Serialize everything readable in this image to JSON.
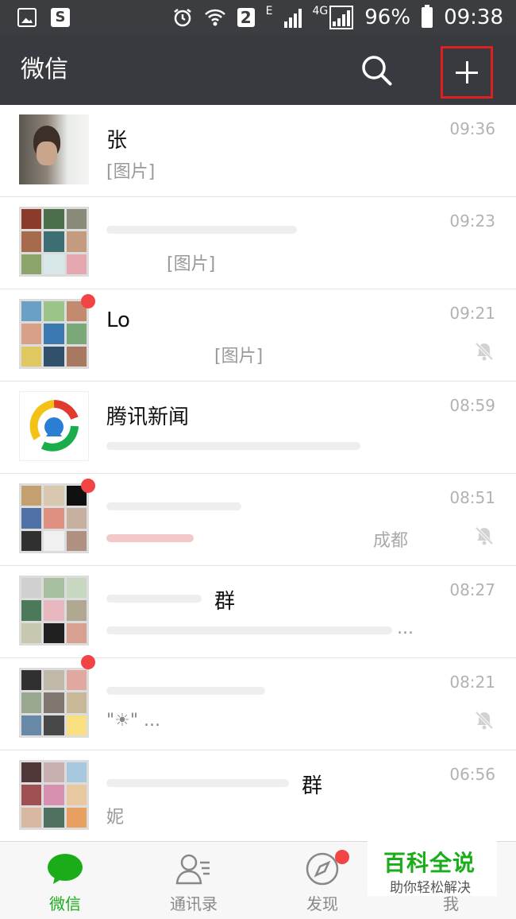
{
  "status_bar": {
    "battery": "96%",
    "time": "09:38",
    "network_badge": "2",
    "net_type": "4G",
    "edge": "E"
  },
  "header": {
    "title": "微信"
  },
  "chats": [
    {
      "name": "张",
      "preview": "[图片]",
      "time": "09:36",
      "muted": false,
      "unread": false
    },
    {
      "name": "",
      "preview": "[图片]",
      "time": "09:23",
      "muted": false,
      "unread": false
    },
    {
      "name": "Lo",
      "preview": "[图片]",
      "time": "09:21",
      "muted": true,
      "unread": true
    },
    {
      "name": "腾讯新闻",
      "preview": "",
      "time": "08:59",
      "muted": false,
      "unread": false
    },
    {
      "name": "",
      "preview": "成都",
      "time": "08:51",
      "muted": true,
      "unread": true
    },
    {
      "name": "群",
      "preview": "...",
      "time": "08:27",
      "muted": false,
      "unread": false
    },
    {
      "name": "",
      "preview": "\"☀\" ...",
      "time": "08:21",
      "muted": true,
      "unread": true
    },
    {
      "name": "群",
      "preview": "妮",
      "time": "06:56",
      "muted": false,
      "unread": false
    }
  ],
  "tabs": [
    {
      "label": "微信",
      "icon": "chat-bubble-icon",
      "active": true
    },
    {
      "label": "通讯录",
      "icon": "contacts-icon",
      "active": false
    },
    {
      "label": "发现",
      "icon": "compass-icon",
      "active": false
    },
    {
      "label": "我",
      "icon": "me-icon",
      "active": false
    }
  ],
  "watermark": {
    "line1": "百科全说",
    "line2": "助你轻松解决"
  },
  "colors": {
    "accent": "#1aad19",
    "header_bg": "#393a3f",
    "badge": "#f24444",
    "highlight": "#e02020"
  }
}
